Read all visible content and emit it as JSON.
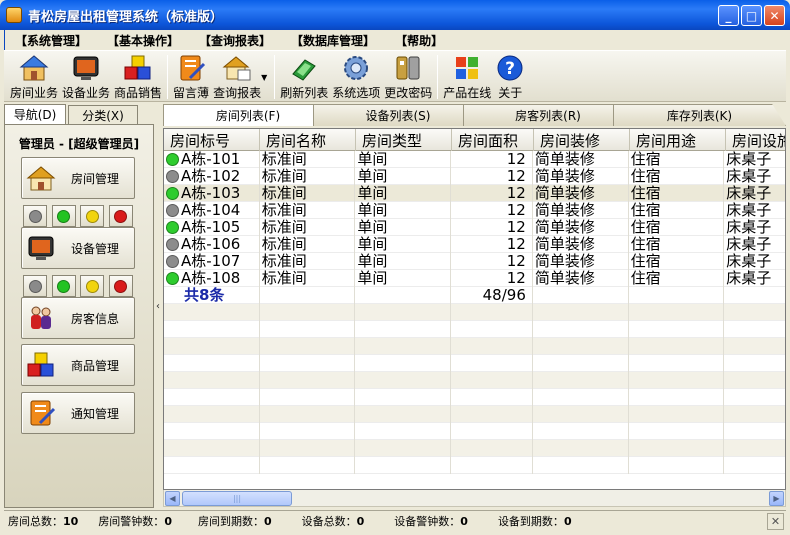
{
  "window": {
    "title": "青松房屋出租管理系统（标准版）"
  },
  "menu": [
    "【系统管理】",
    "【基本操作】",
    "【查询报表】",
    "【数据库管理】",
    "【帮助】"
  ],
  "toolbar": [
    {
      "label": "房间业务",
      "icon": "house-icon"
    },
    {
      "label": "设备业务",
      "icon": "tv-icon"
    },
    {
      "label": "商品销售",
      "icon": "cubes-icon"
    },
    {
      "label": "留言薄",
      "icon": "notebook-icon"
    },
    {
      "label": "查询报表",
      "icon": "report-icon"
    },
    {
      "label": "刷新列表",
      "icon": "refresh-icon"
    },
    {
      "label": "系统选项",
      "icon": "gear-icon"
    },
    {
      "label": "更改密码",
      "icon": "key-icon"
    },
    {
      "label": "产品在线",
      "icon": "windows-logo-icon"
    },
    {
      "label": "关于",
      "icon": "help-icon"
    }
  ],
  "nav": {
    "tabs": [
      "导航(D)",
      "分类(X)"
    ],
    "operator": "管理员 - [超级管理员]",
    "buttons": [
      {
        "label": "房间管理",
        "icon": "house-icon"
      },
      {
        "label": "设备管理",
        "icon": "tv-icon"
      },
      {
        "label": "房客信息",
        "icon": "tenants-icon"
      },
      {
        "label": "商品管理",
        "icon": "cubes-icon"
      },
      {
        "label": "通知管理",
        "icon": "notebook-icon"
      }
    ],
    "light_colors": [
      "#8a8a8a",
      "#22c322",
      "#f1d40e",
      "#d91a1a"
    ]
  },
  "tabs": [
    "房间列表(F)",
    "设备列表(S)",
    "房客列表(R)",
    "库存列表(K)"
  ],
  "table": {
    "columns": [
      "房间标号",
      "房间名称",
      "房间类型",
      "房间面积",
      "房间装修",
      "房间用途",
      "房间设施"
    ],
    "rows": [
      {
        "status": "green",
        "cells": [
          "A栋-101",
          "标准间",
          "单间",
          "12",
          "简单装修",
          "住宿",
          "床桌子"
        ]
      },
      {
        "status": "gray",
        "cells": [
          "A栋-102",
          "标准间",
          "单间",
          "12",
          "简单装修",
          "住宿",
          "床桌子"
        ]
      },
      {
        "status": "green",
        "cells": [
          "A栋-103",
          "标准间",
          "单间",
          "12",
          "简单装修",
          "住宿",
          "床桌子"
        ]
      },
      {
        "status": "gray",
        "cells": [
          "A栋-104",
          "标准间",
          "单间",
          "12",
          "简单装修",
          "住宿",
          "床桌子"
        ]
      },
      {
        "status": "green",
        "cells": [
          "A栋-105",
          "标准间",
          "单间",
          "12",
          "简单装修",
          "住宿",
          "床桌子"
        ]
      },
      {
        "status": "gray",
        "cells": [
          "A栋-106",
          "标准间",
          "单间",
          "12",
          "简单装修",
          "住宿",
          "床桌子"
        ]
      },
      {
        "status": "gray",
        "cells": [
          "A栋-107",
          "标准间",
          "单间",
          "12",
          "简单装修",
          "住宿",
          "床桌子"
        ]
      },
      {
        "status": "green",
        "cells": [
          "A栋-108",
          "标准间",
          "单间",
          "12",
          "简单装修",
          "住宿",
          "床桌子"
        ]
      }
    ],
    "summary": {
      "count": "共8条",
      "area": "48/96"
    },
    "status_colors": {
      "green": "#2ecc2e",
      "gray": "#8c8c8c"
    }
  },
  "statusbar": [
    {
      "label": "房间总数：",
      "value": "10"
    },
    {
      "label": "房间警钟数：",
      "value": "0"
    },
    {
      "label": "房间到期数：",
      "value": "0"
    },
    {
      "label": "设备总数：",
      "value": "0"
    },
    {
      "label": "设备警钟数：",
      "value": "0"
    },
    {
      "label": "设备到期数：",
      "value": "0"
    }
  ]
}
